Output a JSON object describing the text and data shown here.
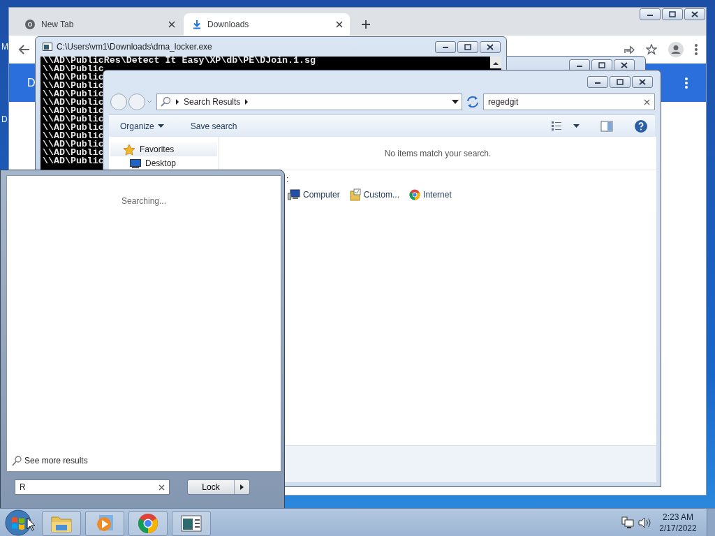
{
  "desktop": {
    "icon_labels": [
      "M",
      "D"
    ]
  },
  "browser": {
    "tabs": [
      {
        "label": "New Tab",
        "selected": false
      },
      {
        "label": "Downloads",
        "selected": true
      }
    ],
    "page_heading": "D"
  },
  "console": {
    "title": "C:\\Users\\vm1\\Downloads\\dma_locker.exe",
    "lines": [
      "\\\\AD\\PublicRes\\Detect It Easy\\XP\\db\\PE\\DJoin.1.sg",
      "\\\\AD\\Public",
      "\\\\AD\\Public",
      "\\\\AD\\Public",
      "\\\\AD\\Public",
      "\\\\AD\\Public",
      "\\\\AD\\Public",
      "\\\\AD\\Public",
      "\\\\AD\\Public",
      "\\\\AD\\Public",
      "\\\\AD\\Public",
      "\\\\AD\\Public",
      "\\\\AD\\Public"
    ]
  },
  "explorer": {
    "address": "Search Results",
    "search_value": "regedgit",
    "toolbar": [
      "Organize",
      "Save search"
    ],
    "nav": [
      {
        "label": "Favorites",
        "kind": "favorites"
      },
      {
        "label": "Desktop",
        "kind": "desktop"
      }
    ],
    "message": "No items match your search.",
    "search_again_label": ":",
    "search_again": [
      {
        "label": "Computer",
        "kind": "computer"
      },
      {
        "label": "Custom...",
        "kind": "custom"
      },
      {
        "label": "Internet",
        "kind": "internet"
      }
    ]
  },
  "start_menu": {
    "status": "Searching...",
    "see_more": "See more results",
    "search_value": "R",
    "power_button": "Lock"
  },
  "taskbar": {
    "clock_time": "2:23 AM",
    "clock_date": "2/17/2022"
  }
}
